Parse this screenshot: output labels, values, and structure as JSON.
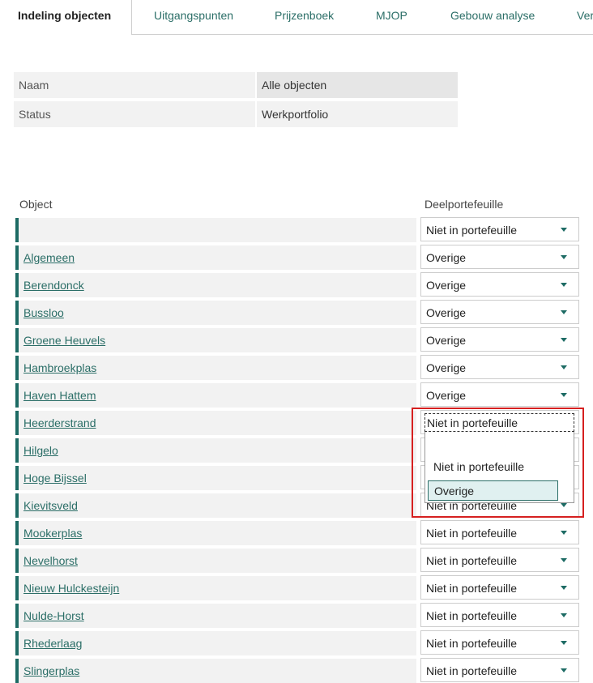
{
  "tabs": [
    {
      "label": "Indeling objecten",
      "active": true
    },
    {
      "label": "Uitgangspunten"
    },
    {
      "label": "Prijzenboek"
    },
    {
      "label": "MJOP"
    },
    {
      "label": "Gebouw analyse"
    },
    {
      "label": "Ver"
    }
  ],
  "info": {
    "name_label": "Naam",
    "name_value": "Alle objecten",
    "status_label": "Status",
    "status_value": "Werkportfolio"
  },
  "columns": {
    "object": "Object",
    "portfolio": "Deelportefeuille"
  },
  "rows": [
    {
      "name": "",
      "portfolio": "Niet in portefeuille"
    },
    {
      "name": "Algemeen",
      "portfolio": "Overige"
    },
    {
      "name": "Berendonck",
      "portfolio": "Overige"
    },
    {
      "name": "Bussloo",
      "portfolio": "Overige"
    },
    {
      "name": "Groene Heuvels",
      "portfolio": "Overige"
    },
    {
      "name": "Hambroekplas",
      "portfolio": "Overige"
    },
    {
      "name": "Haven Hattem",
      "portfolio": "Overige"
    },
    {
      "name": "Heerderstrand",
      "portfolio": "Niet in portefeuille"
    },
    {
      "name": "Hilgelo",
      "portfolio": ""
    },
    {
      "name": "Hoge Bijssel",
      "portfolio": ""
    },
    {
      "name": "Kievitsveld",
      "portfolio": "Niet in portefeuille"
    },
    {
      "name": "Mookerplas",
      "portfolio": "Niet in portefeuille"
    },
    {
      "name": "Nevelhorst",
      "portfolio": "Niet in portefeuille"
    },
    {
      "name": "Nieuw Hulckesteijn",
      "portfolio": "Niet in portefeuille"
    },
    {
      "name": "Nulde-Horst",
      "portfolio": "Niet in portefeuille"
    },
    {
      "name": "Rhederlaag",
      "portfolio": "Niet in portefeuille"
    },
    {
      "name": "Slingerplas",
      "portfolio": "Niet in portefeuille"
    }
  ],
  "dropdown": {
    "current": "Niet in portefeuille",
    "options": [
      "Niet in portefeuille",
      "Overige"
    ],
    "selected_index": 1
  }
}
